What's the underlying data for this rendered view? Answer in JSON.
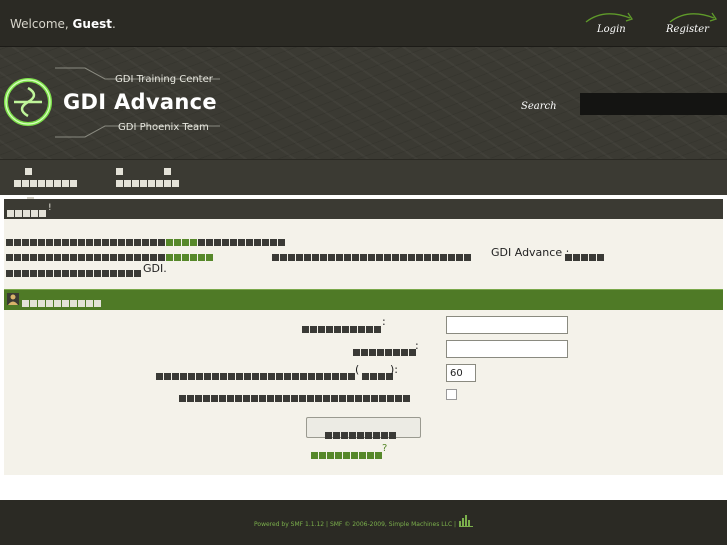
{
  "topbar": {
    "welcome_prefix": "Welcome,",
    "welcome_user": "Guest",
    "welcome_suffix": ".",
    "login_label": "Login",
    "register_label": "Register"
  },
  "banner": {
    "logo_title": "GDI Advance",
    "logo_subtitle_top": "GDI Training Center",
    "logo_subtitle_bottom": "GDI Phoenix Team",
    "search_label": "Search"
  },
  "notice": {
    "bang": "!",
    "gdi_advance": "GDI Advance :",
    "gdi_end": "GDI."
  },
  "login": {
    "colon1": ":",
    "colon2": ":",
    "paren_open": "(",
    "paren_close": "):",
    "session_length_value": "60",
    "question_mark": "?"
  },
  "footer": {
    "text": "Powered by SMF 1.1.12 | SMF © 2006-2009, Simple Machines LLC |"
  },
  "colors": {
    "dark": "#2b2a24",
    "banner": "#3b3a33",
    "content_bg": "#f4f2ea",
    "green": "#56882a",
    "login_bar": "#4f7a26"
  }
}
